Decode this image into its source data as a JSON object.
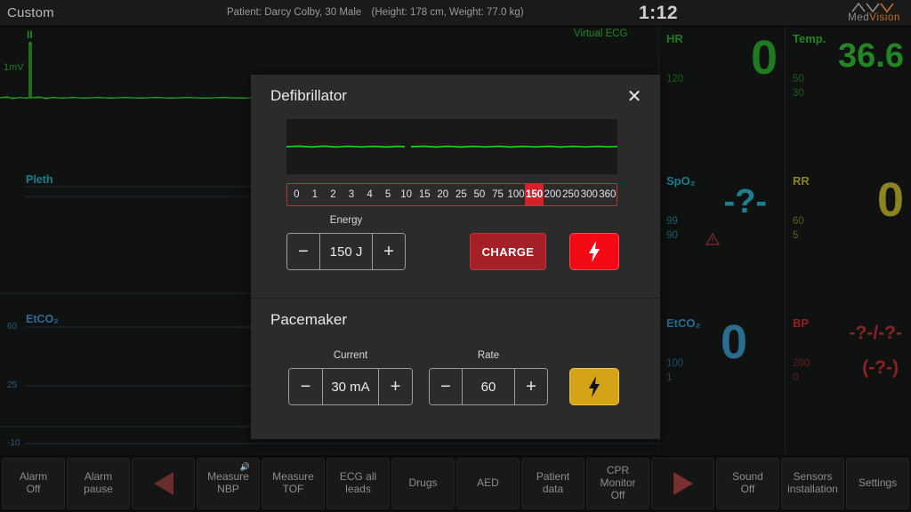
{
  "topbar": {
    "profile": "Custom",
    "patient": "Patient: Darcy Colby, 30 Male",
    "patient_meta": "(Height: 178 cm, Weight: 77.0 kg)",
    "time": "1:12",
    "logo_med": "Med",
    "logo_vision": "Vision",
    "logo_mark_icon": "medvision-logo-icon"
  },
  "waveforms": {
    "ecg": {
      "lead": "II",
      "calibration": "1mV",
      "virtual_label": "Virtual ECG",
      "color": "#1f8a1f"
    },
    "pleth": {
      "label": "Pleth",
      "color": "#1a7f8c"
    },
    "etco2": {
      "label": "EtCO₂",
      "color": "#2e6c91",
      "ticks": [
        "60",
        "25",
        "-10"
      ]
    }
  },
  "vitals": [
    {
      "key": "hr",
      "label": "HR",
      "value": "0",
      "limit_high": "120",
      "limit_low": "",
      "color": "#1d7a1d",
      "alarm": false
    },
    {
      "key": "temp",
      "label": "Temp.",
      "value": "36.6",
      "limit_high": "50",
      "limit_low": "30",
      "color": "#238523",
      "alarm": false
    },
    {
      "key": "spo2",
      "label": "SpO₂",
      "value": "-?-",
      "limit_high": "99",
      "limit_low": "90",
      "color": "#1a8090",
      "alarm": true,
      "alarm_icon": "alarm-triangle-icon"
    },
    {
      "key": "rr",
      "label": "RR",
      "value": "0",
      "limit_high": "60",
      "limit_low": "5",
      "color": "#8a8320",
      "alarm": false
    },
    {
      "key": "etco2",
      "label": "EtCO₂",
      "value": "0",
      "limit_high": "100",
      "limit_low": "1",
      "color": "#2a6d90",
      "alarm": false
    },
    {
      "key": "bp",
      "label": "BP",
      "value": "-?-/-?-",
      "value2": "(-?-)",
      "limit_high": "200",
      "limit_low": "0",
      "color": "#8e2222",
      "alarm": false
    }
  ],
  "dialog": {
    "defibrillator": {
      "title": "Defibrillator",
      "close_icon": "close-icon",
      "energy_scale": [
        "0",
        "1",
        "2",
        "3",
        "4",
        "5",
        "10",
        "15",
        "20",
        "25",
        "50",
        "75",
        "100",
        "150",
        "200",
        "250",
        "300",
        "360"
      ],
      "energy_selected": "150",
      "energy_label": "Energy",
      "energy_value": "150 J",
      "minus_label": "−",
      "plus_label": "+",
      "charge_label": "CHARGE",
      "shock_icon": "shock-bolt-icon",
      "accent_red": "#d8202a",
      "charge_red": "#a51f26"
    },
    "pacemaker": {
      "title": "Pacemaker",
      "current_label": "Current",
      "current_value": "30 mA",
      "rate_label": "Rate",
      "rate_value": "60",
      "minus_label": "−",
      "plus_label": "+",
      "pace_icon": "pace-bolt-icon",
      "accent_gold": "#d5a316"
    }
  },
  "toolbar": [
    {
      "label": "Alarm\nOff",
      "name": "alarm-off",
      "type": "text"
    },
    {
      "label": "Alarm pause",
      "name": "alarm-pause",
      "type": "text"
    },
    {
      "label": "",
      "name": "prev-page",
      "type": "arrow-left",
      "icon": "arrow-left-icon"
    },
    {
      "label": "Measure\nNBP",
      "name": "measure-nbp",
      "type": "text",
      "icon": "speaker-icon",
      "badge": "🔊"
    },
    {
      "label": "Measure\nTOF",
      "name": "measure-tof",
      "type": "text"
    },
    {
      "label": "ECG all\nleads",
      "name": "ecg-all-leads",
      "type": "text"
    },
    {
      "label": "Drugs",
      "name": "drugs",
      "type": "text"
    },
    {
      "label": "AED",
      "name": "aed",
      "type": "text"
    },
    {
      "label": "Patient data",
      "name": "patient-data",
      "type": "text"
    },
    {
      "label": "CPR\nMonitor\nOff",
      "name": "cpr-monitor-off",
      "type": "text"
    },
    {
      "label": "",
      "name": "next-page",
      "type": "arrow-right",
      "icon": "arrow-right-icon"
    },
    {
      "label": "Sound\nOff",
      "name": "sound-off",
      "type": "text"
    },
    {
      "label": "Sensors\ninstallation",
      "name": "sensors-installation",
      "type": "text"
    },
    {
      "label": "Settings",
      "name": "settings",
      "type": "text"
    }
  ]
}
